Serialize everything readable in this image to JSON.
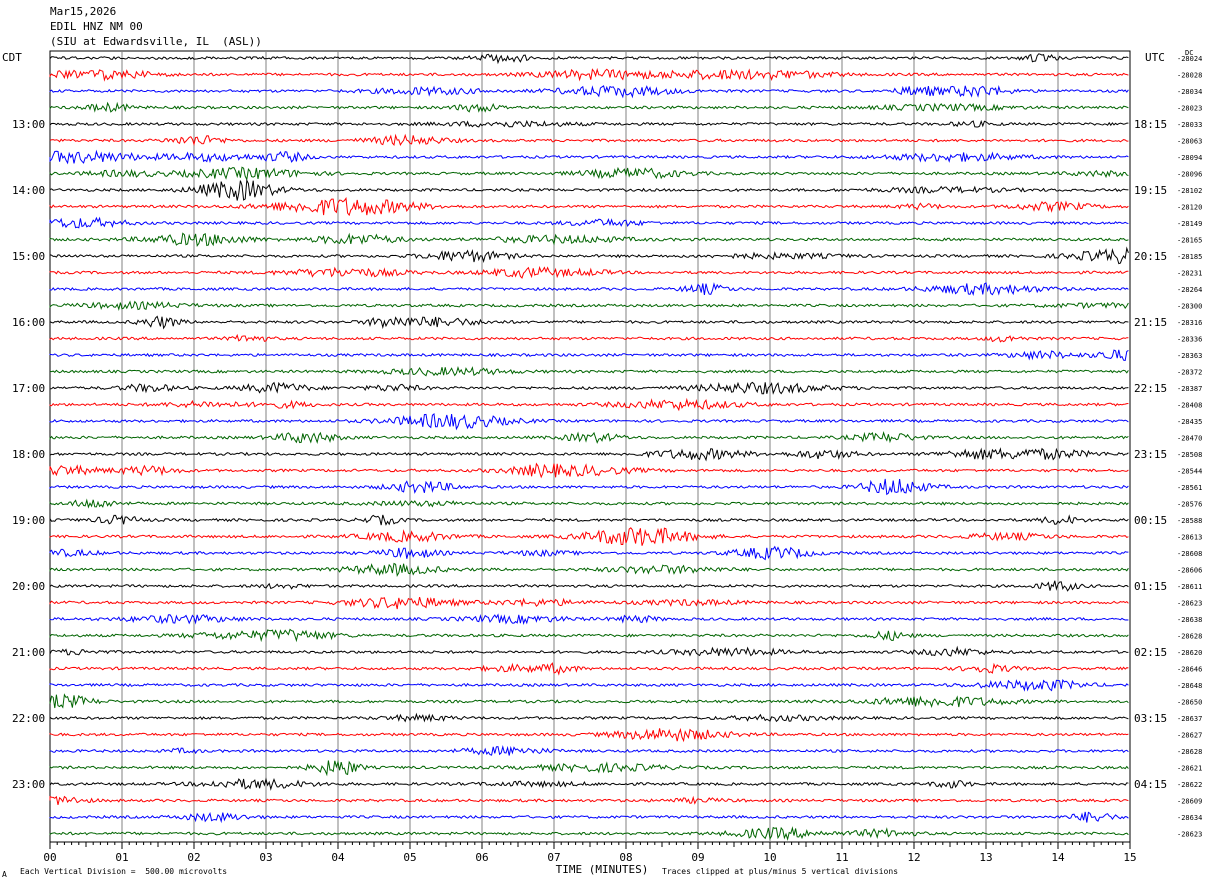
{
  "header": {
    "date": "Mar15,2026",
    "station": "EDIL HNZ NM 00",
    "location": "(SIU at Edwardsville, IL  (ASL))"
  },
  "left_tz": "CDT",
  "right_tz": "UTC",
  "dc_label": "DC",
  "footer": {
    "scale_note": "Each Vertical Division =  500.00 microvolts",
    "clip_note": "Traces clipped at plus/minus 5 vertical divisions",
    "corner_mark": "A"
  },
  "colors": {
    "trace_cycle": [
      "#000000",
      "#ff0000",
      "#0000ff",
      "#006400"
    ],
    "grid": "#808080"
  },
  "chart_data": {
    "type": "line",
    "xlabel": "TIME (MINUTES)",
    "xlim": [
      0,
      15
    ],
    "x_ticks": [
      "00",
      "01",
      "02",
      "03",
      "04",
      "05",
      "06",
      "07",
      "08",
      "09",
      "10",
      "11",
      "12",
      "13",
      "14",
      "15"
    ],
    "rows_per_hour": 4,
    "left_hour_labels": [
      {
        "row": 4,
        "label": "13:00"
      },
      {
        "row": 8,
        "label": "14:00"
      },
      {
        "row": 12,
        "label": "15:00"
      },
      {
        "row": 16,
        "label": "16:00"
      },
      {
        "row": 20,
        "label": "17:00"
      },
      {
        "row": 24,
        "label": "18:00"
      },
      {
        "row": 28,
        "label": "19:00"
      },
      {
        "row": 32,
        "label": "20:00"
      },
      {
        "row": 36,
        "label": "21:00"
      },
      {
        "row": 40,
        "label": "22:00"
      },
      {
        "row": 44,
        "label": "23:00"
      }
    ],
    "right_hour_labels": [
      {
        "row": 4,
        "label": "18:15"
      },
      {
        "row": 8,
        "label": "19:15"
      },
      {
        "row": 12,
        "label": "20:15"
      },
      {
        "row": 16,
        "label": "21:15"
      },
      {
        "row": 20,
        "label": "22:15"
      },
      {
        "row": 24,
        "label": "23:15"
      },
      {
        "row": 28,
        "label": "00:15"
      },
      {
        "row": 32,
        "label": "01:15"
      },
      {
        "row": 36,
        "label": "02:15"
      },
      {
        "row": 40,
        "label": "03:15"
      },
      {
        "row": 44,
        "label": "04:15"
      }
    ],
    "dc_offsets": [
      "-28024",
      "-28028",
      "-28034",
      "-28023",
      "-28033",
      "-28063",
      "-28094",
      "-28096",
      "-28102",
      "-28120",
      "-28149",
      "-28165",
      "-28185",
      "-28231",
      "-28264",
      "-28300",
      "-28316",
      "-28336",
      "-28363",
      "-28372",
      "-28387",
      "-28408",
      "-28435",
      "-28470",
      "-28508",
      "-28544",
      "-28561",
      "-28576",
      "-28588",
      "-28613",
      "-28608",
      "-28606",
      "-28611",
      "-28623",
      "-28638",
      "-28628",
      "-28620",
      "-28646",
      "-28648",
      "-28650",
      "-28637",
      "-28627",
      "-28628",
      "-28621",
      "-28622",
      "-28609",
      "-28634",
      "-28623"
    ]
  }
}
